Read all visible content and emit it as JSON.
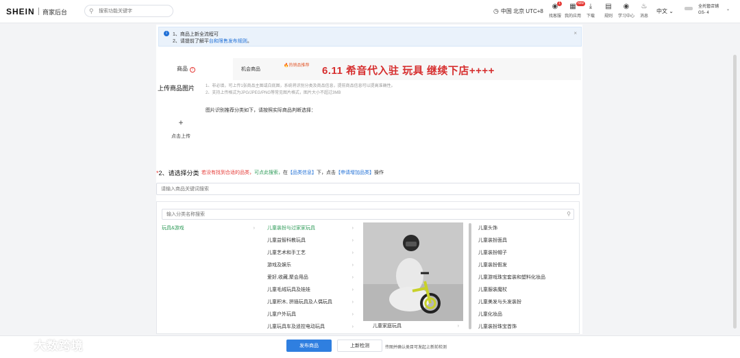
{
  "header": {
    "logo": "SHEIN",
    "subtitle": "商家后台",
    "search_placeholder": "搜索功能关键字",
    "timezone": "中国 北京 UTC+8",
    "tools": [
      {
        "icon": "headset-icon",
        "label": "找客服",
        "badge": "1"
      },
      {
        "icon": "grid-icon",
        "label": "我的应用",
        "badge": "new"
      },
      {
        "icon": "download-icon",
        "label": "下载",
        "badge": ""
      },
      {
        "icon": "document-icon",
        "label": "规则",
        "badge": ""
      },
      {
        "icon": "learn-icon",
        "label": "学习中心",
        "badge": ""
      },
      {
        "icon": "bell-icon",
        "label": "消息",
        "badge": ""
      }
    ],
    "language": "中文",
    "user_name": "全托管店铺",
    "user_id": "GS-      4"
  },
  "notice": {
    "line1": "1、商品上新全流程可",
    "line2_prefix": "2、请提前了解平",
    "line2_link": "台和限售发布规则",
    "line2_suffix": "。"
  },
  "product": {
    "name_label": "商品",
    "opportunity_label": "机会商品",
    "opportunity_tag": "🔥热销品推荐",
    "banner": "6.11 希音代入驻 玩具 继续下店++++"
  },
  "upload": {
    "label": "上传商品图片",
    "hint_line1": "1、非必填，可上传1张商品主图或白底图，系统将识别分类及商品信息，提前商品信息可以提高准确性。",
    "hint_line2": "2、支持上传格式为JPG/JPEG/PNG等常见图片格式，图片大小不超过3MB",
    "recognize_text": "图片识别推荐分类如下，请按照实际商品判断选择：",
    "plus": "+",
    "button_label": "点击上传"
  },
  "category": {
    "required_mark": "*",
    "label": "2、请选择分类",
    "note_red": "若没有找到合适的品类，",
    "note_green": "可点此搜索，",
    "note_mid": "在",
    "note_blue1": "【品类信息】",
    "note_mid2": "下，点击",
    "note_blue2": "【申请增加品类】",
    "note_end": "操作",
    "search_placeholder": "请输入商品关键词搜索",
    "inner_search_placeholder": "输入分类名称搜索",
    "level1": [
      {
        "label": "玩具&游戏",
        "active": true
      }
    ],
    "level2": [
      {
        "label": "儿童装扮与过家家玩具",
        "active": true
      },
      {
        "label": "儿童益智科教玩具",
        "active": false
      },
      {
        "label": "儿童艺术和手工艺",
        "active": false
      },
      {
        "label": "游戏及娱乐",
        "active": false
      },
      {
        "label": "爱好,收藏,聚会用品",
        "active": false
      },
      {
        "label": "儿童毛绒玩具及娃娃",
        "active": false
      },
      {
        "label": "儿童积木, 拼插玩具及人偶玩具",
        "active": false
      },
      {
        "label": "儿童户外玩具",
        "active": false
      },
      {
        "label": "儿童玩具车及遥控电动玩具",
        "active": false
      }
    ],
    "level3_caption": "儿童家庭玩具",
    "level4": [
      "儿童头饰",
      "儿童装扮面具",
      "儿童装扮帽子",
      "儿童装扮假发",
      "儿童游戏珠宝套装和塑料化妆品",
      "儿童服装魔杖",
      "儿童美发与头发装扮",
      "儿童化妆品",
      "儿童装扮珠宝首饰"
    ]
  },
  "footer": {
    "publish": "发布商品",
    "recheck": "上新检测",
    "note": "传图并确认类目可发起上新前检测"
  },
  "watermark": "大数跨境",
  "colors": {
    "primary": "#2f7fe0",
    "active_green": "#2e9b58",
    "alert_red": "#d62e2e"
  }
}
